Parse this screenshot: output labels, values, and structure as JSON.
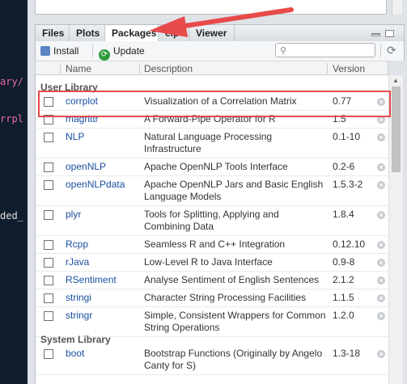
{
  "editor": {
    "fragments": [
      "ary/",
      "rrpl",
      "ded_"
    ],
    "fragment_colors": [
      "#e86bb0",
      "#e86bb0",
      "#e0e0e0"
    ]
  },
  "tabs": [
    "Files",
    "Plots",
    "Packages",
    "elp",
    "Viewer"
  ],
  "active_tab": "Packages",
  "toolbar": {
    "install_label": "Install",
    "update_label": "Update",
    "search_placeholder": ""
  },
  "columns": {
    "name": "Name",
    "description": "Description",
    "version": "Version"
  },
  "user_library_label": "User Library",
  "system_library_label": "System Library",
  "user_packages": [
    {
      "name": "corrplot",
      "description": "Visualization of a Correlation Matrix",
      "version": "0.77"
    },
    {
      "name": "magrittr",
      "description": "A Forward-Pipe Operator for R",
      "version": "1.5"
    },
    {
      "name": "NLP",
      "description": "Natural Language Processing Infrastructure",
      "version": "0.1-10"
    },
    {
      "name": "openNLP",
      "description": "Apache OpenNLP Tools Interface",
      "version": "0.2-6"
    },
    {
      "name": "openNLPdata",
      "description": "Apache OpenNLP Jars and Basic English Language Models",
      "version": "1.5.3-2"
    },
    {
      "name": "plyr",
      "description": "Tools for Splitting, Applying and Combining Data",
      "version": "1.8.4"
    },
    {
      "name": "Rcpp",
      "description": "Seamless R and C++ Integration",
      "version": "0.12.10"
    },
    {
      "name": "rJava",
      "description": "Low-Level R to Java Interface",
      "version": "0.9-8"
    },
    {
      "name": "RSentiment",
      "description": "Analyse Sentiment of English Sentences",
      "version": "2.1.2"
    },
    {
      "name": "stringi",
      "description": "Character String Processing Facilities",
      "version": "1.1.5"
    },
    {
      "name": "stringr",
      "description": "Simple, Consistent Wrappers for Common String Operations",
      "version": "1.2.0"
    }
  ],
  "system_packages": [
    {
      "name": "boot",
      "description": "Bootstrap Functions (Originally by Angelo Canty for S)",
      "version": "1.3-18"
    }
  ],
  "colors": {
    "highlight": "#e84a4a",
    "link": "#1b4fa0",
    "update_icon": "#2e9b3a"
  }
}
